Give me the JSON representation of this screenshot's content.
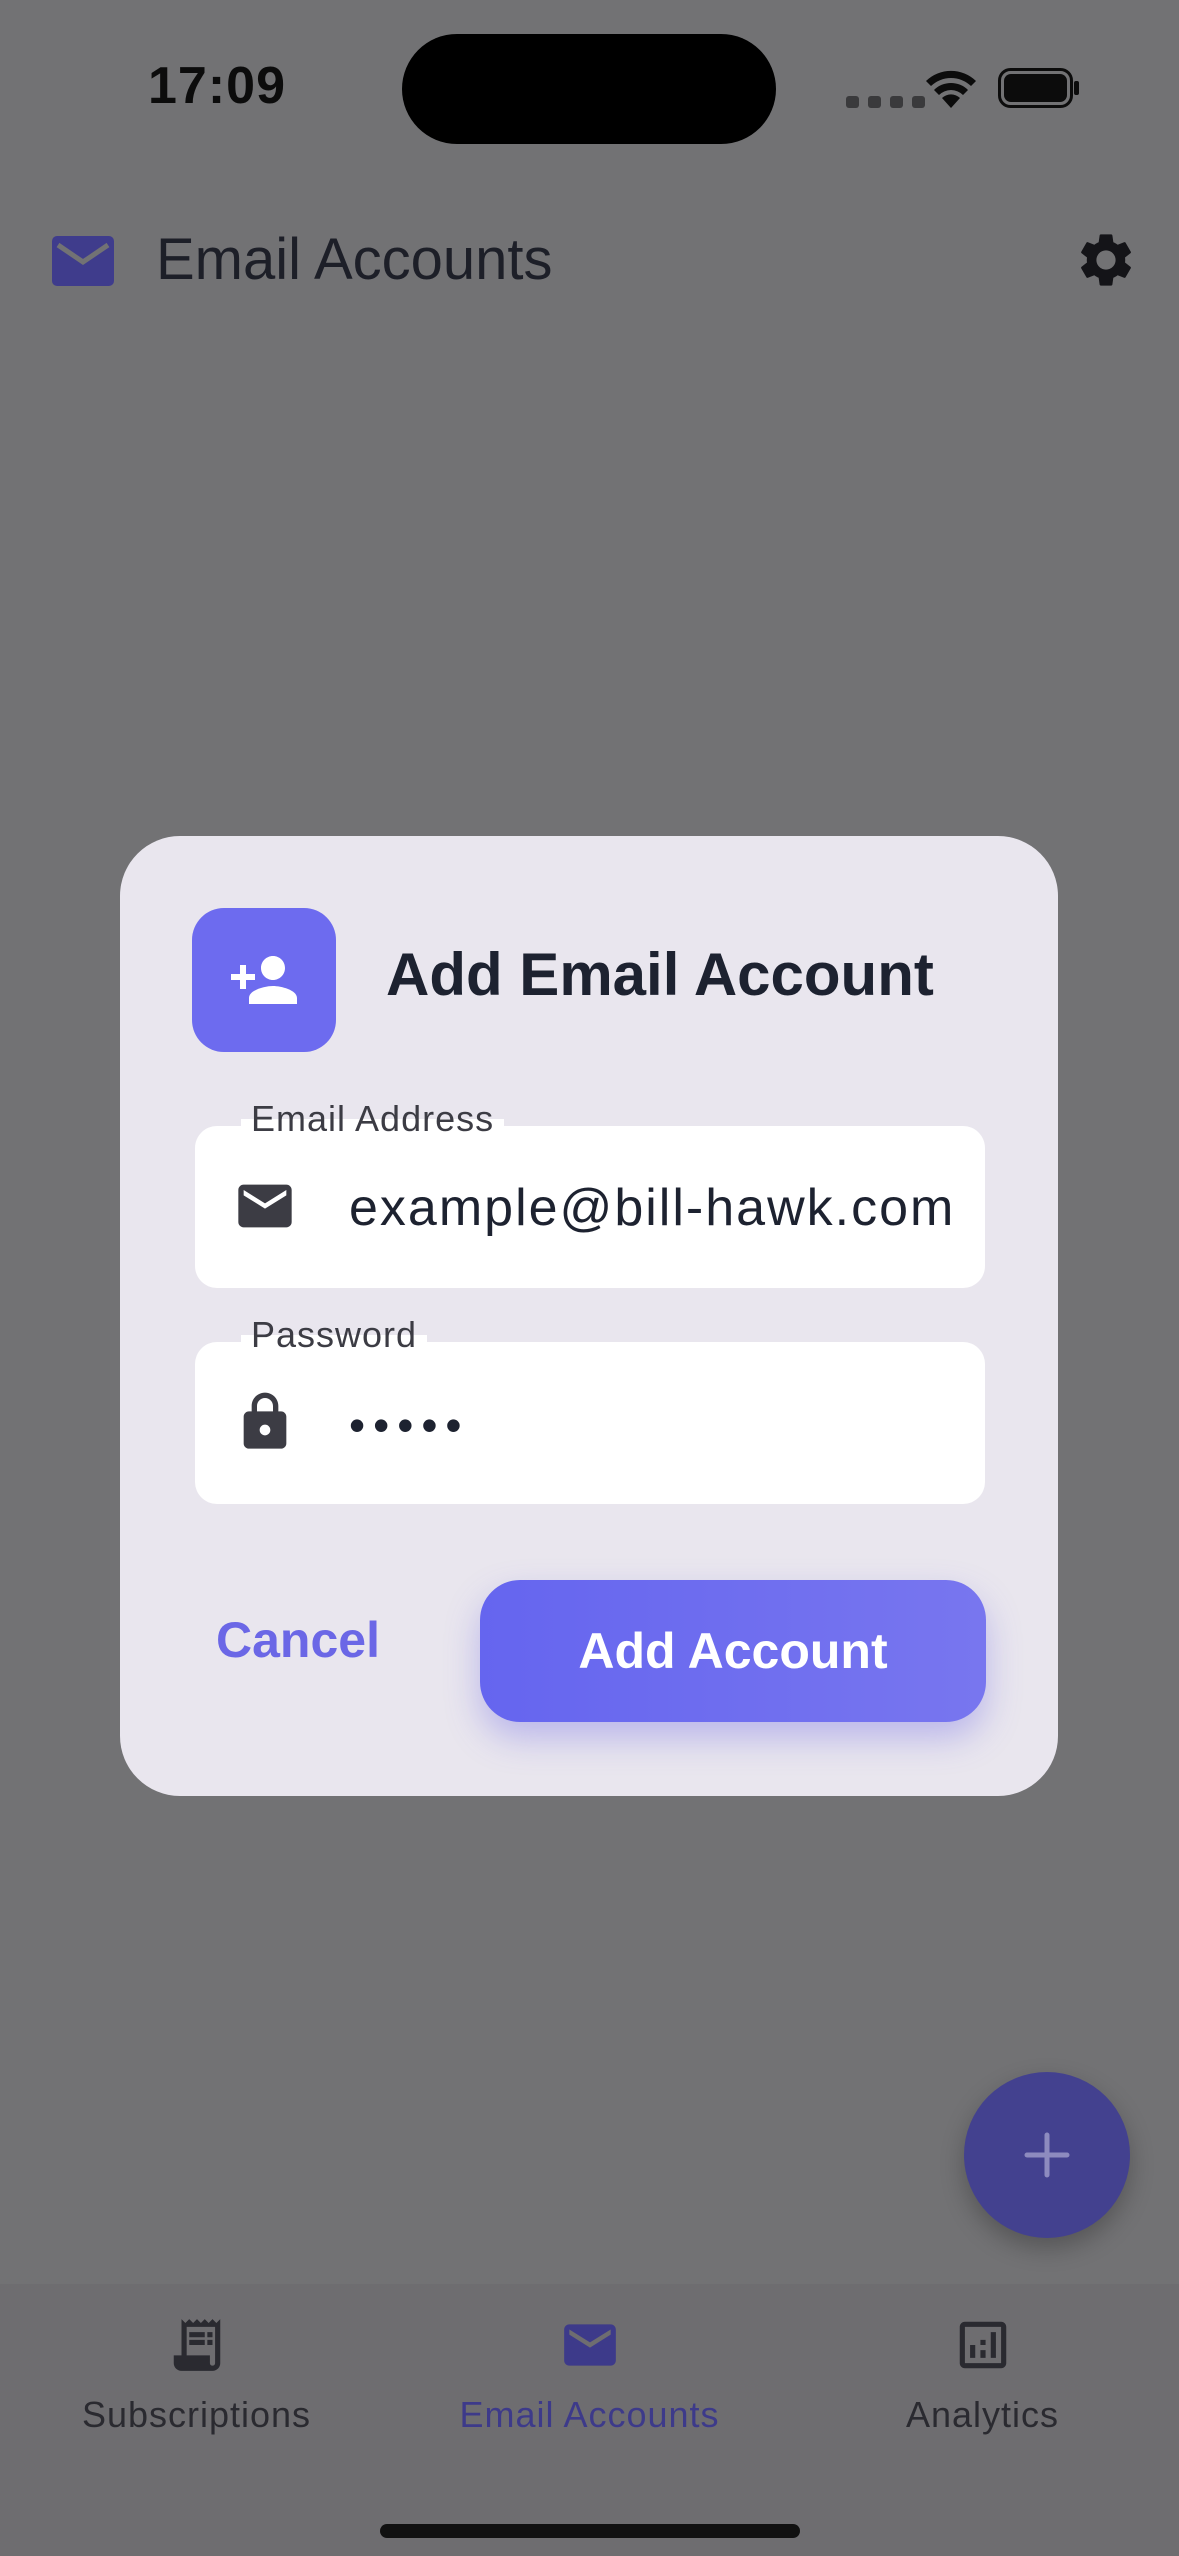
{
  "status_bar": {
    "time": "17:09"
  },
  "app_bar": {
    "title": "Email Accounts"
  },
  "dialog": {
    "title": "Add Email Account",
    "email_label": "Email Address",
    "email_value": "example@bill-hawk.com",
    "password_label": "Password",
    "password_value": "•••••",
    "cancel_label": "Cancel",
    "add_label": "Add Account"
  },
  "fab": {
    "symbol": "+"
  },
  "bottom_nav": {
    "items": [
      {
        "label": "Subscriptions",
        "icon": "receipt-icon"
      },
      {
        "label": "Email Accounts",
        "icon": "mail-icon",
        "active": true
      },
      {
        "label": "Analytics",
        "icon": "analytics-icon"
      }
    ]
  },
  "colors": {
    "accent": "#6d6bef",
    "overlay": "#727274",
    "dialog_bg": "#e9e6ee",
    "nav_active": "#3d3a8a"
  }
}
